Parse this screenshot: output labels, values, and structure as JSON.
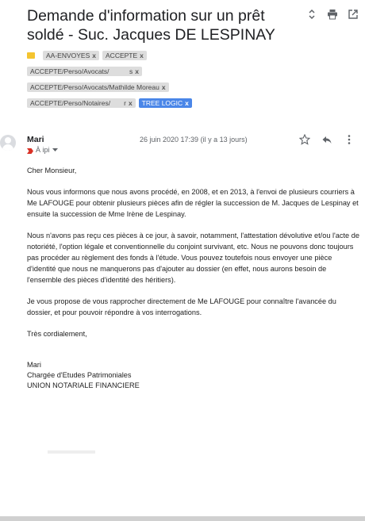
{
  "subject": "Demande d'information sur un prêt soldé - Suc. Jacques DE LESPINAY",
  "labels": [
    [
      "AA-ENVOYES",
      "ACCEPTE"
    ],
    [
      "ACCEPTE/Perso/Avocats/               s"
    ],
    [
      "ACCEPTE/Perso/Avocats/Mathilde Moreau"
    ],
    [
      "ACCEPTE/Perso/Notaires/          r",
      "TREE LOGIC"
    ]
  ],
  "label_close": "x",
  "sender": "Mari",
  "date": "26 juin 2020 17:39 (il y a 13 jours)",
  "to": "À ipi",
  "body": {
    "greeting": "Cher Monsieur,",
    "p1": "Nous vous informons que nous avons procédé, en 2008, et en 2013, à l'envoi de plusieurs courriers à Me LAFOUGE pour obtenir plusieurs pièces afin de régler la succession de M. Jacques de Lespinay et ensuite la succession de Mme Irène de Lespinay.",
    "p2": "Nous n'avons pas reçu ces pièces à ce jour, à savoir, notamment, l'attestation dévolutive et/ou l'acte de notoriété, l'option légale et conventionnelle du conjoint survivant, etc. Nous ne pouvons donc toujours pas procéder au règlement des fonds à l'étude. Vous pouvez toutefois nous envoyer une pièce d'identité que nous ne manquerons pas d'ajouter au dossier (en effet, nous aurons besoin de l'ensemble des pièces d'identité des héritiers).",
    "p3": "Je vous propose de vous rapprocher directement de Me LAFOUGE pour connaître l'avancée du dossier, et pour pouvoir répondre à vos interrogations.",
    "closing": "Très cordialement,",
    "sig_name": "Mari",
    "sig_title": "Chargée d'Etudes Patrimoniales",
    "sig_company": "UNION NOTARIALE FINANCIERE"
  },
  "icons": {
    "expand": "unfold-more-icon",
    "print": "print-icon",
    "open_new": "open-in-new-window-icon",
    "star": "star-icon",
    "reply": "reply-icon",
    "more": "more-vert-icon",
    "important": "important-marker-icon",
    "folder": "folder-icon",
    "avatar": "avatar-icon",
    "dropdown": "caret-down-icon"
  },
  "colors": {
    "accent_label": "#4a86e8",
    "important": "#d93025",
    "folder": "#f4c430"
  }
}
